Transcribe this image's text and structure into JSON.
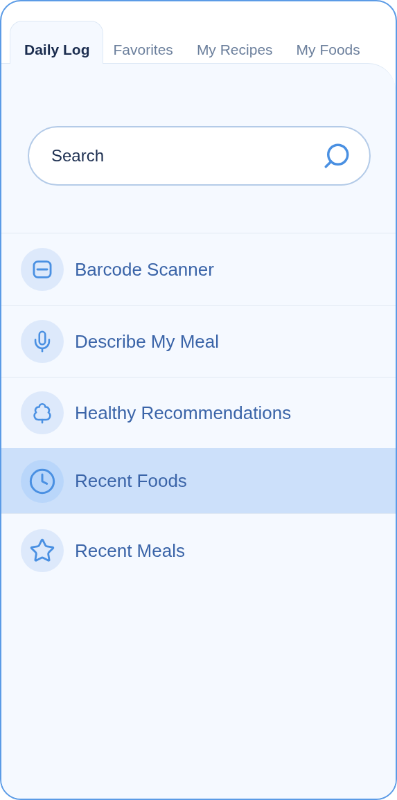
{
  "tabs": [
    {
      "label": "Daily Log",
      "selected": true
    },
    {
      "label": "Favorites",
      "selected": false
    },
    {
      "label": "My Recipes",
      "selected": false
    },
    {
      "label": "My Foods",
      "selected": false
    }
  ],
  "search": {
    "placeholder": "Search"
  },
  "items": [
    {
      "kind": "barcode",
      "label": "Barcode Scanner",
      "selected": false
    },
    {
      "kind": "mic",
      "label": "Describe My Meal",
      "selected": false
    },
    {
      "kind": "tree",
      "label": "Healthy Recommendations",
      "selected": false
    },
    {
      "kind": "clock",
      "label": "Recent Foods",
      "selected": true
    },
    {
      "kind": "star",
      "label": "Recent Meals",
      "selected": false
    }
  ]
}
